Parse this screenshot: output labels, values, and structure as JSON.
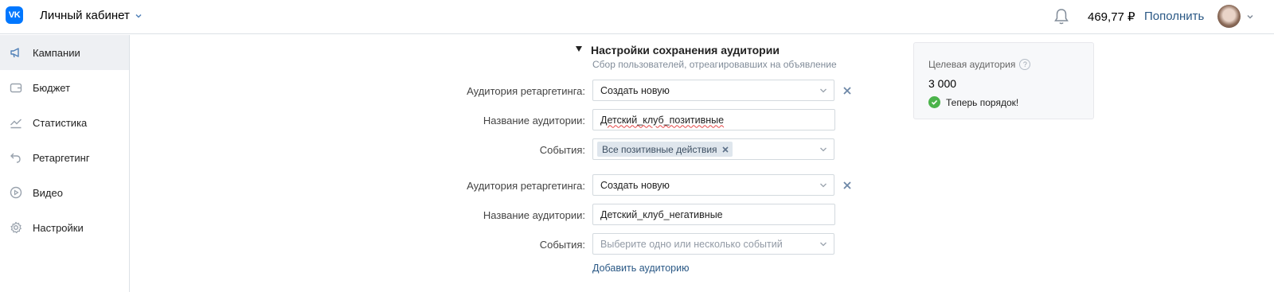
{
  "header": {
    "logo_text": "VK",
    "cabinet_label": "Личный кабинет",
    "balance": "469,77 ₽",
    "topup_label": "Пополнить"
  },
  "sidebar": {
    "items": [
      {
        "label": "Кампании",
        "icon": "megaphone-icon",
        "active": true
      },
      {
        "label": "Бюджет",
        "icon": "wallet-icon",
        "active": false
      },
      {
        "label": "Статистика",
        "icon": "chart-icon",
        "active": false
      },
      {
        "label": "Ретаргетинг",
        "icon": "undo-arrow-icon",
        "active": false
      },
      {
        "label": "Видео",
        "icon": "play-icon",
        "active": false
      },
      {
        "label": "Настройки",
        "icon": "gear-icon",
        "active": false
      }
    ]
  },
  "section": {
    "title": "Настройки сохранения аудитории",
    "subtitle": "Сбор пользователей, отреагировавших на объявление"
  },
  "audiences": [
    {
      "retarget_label": "Аудитория ретаргетинга:",
      "retarget_value": "Создать новую",
      "name_label": "Название аудитории:",
      "name_value": "Детский_клуб_позитивные",
      "events_label": "События:",
      "events_tag": "Все позитивные действия",
      "events_placeholder": ""
    },
    {
      "retarget_label": "Аудитория ретаргетинга:",
      "retarget_value": "Создать новую",
      "name_label": "Название аудитории:",
      "name_value": "Детский_клуб_негативные",
      "events_label": "События:",
      "events_tag": "",
      "events_placeholder": "Выберите одно или несколько событий"
    }
  ],
  "add_audience_label": "Добавить аудиторию",
  "card": {
    "title": "Целевая аудитория",
    "help": "?",
    "value": "3 000",
    "status": "Теперь порядок!"
  },
  "colors": {
    "accent": "#2a5885",
    "brand": "#0077ff",
    "success": "#4bb34b"
  }
}
